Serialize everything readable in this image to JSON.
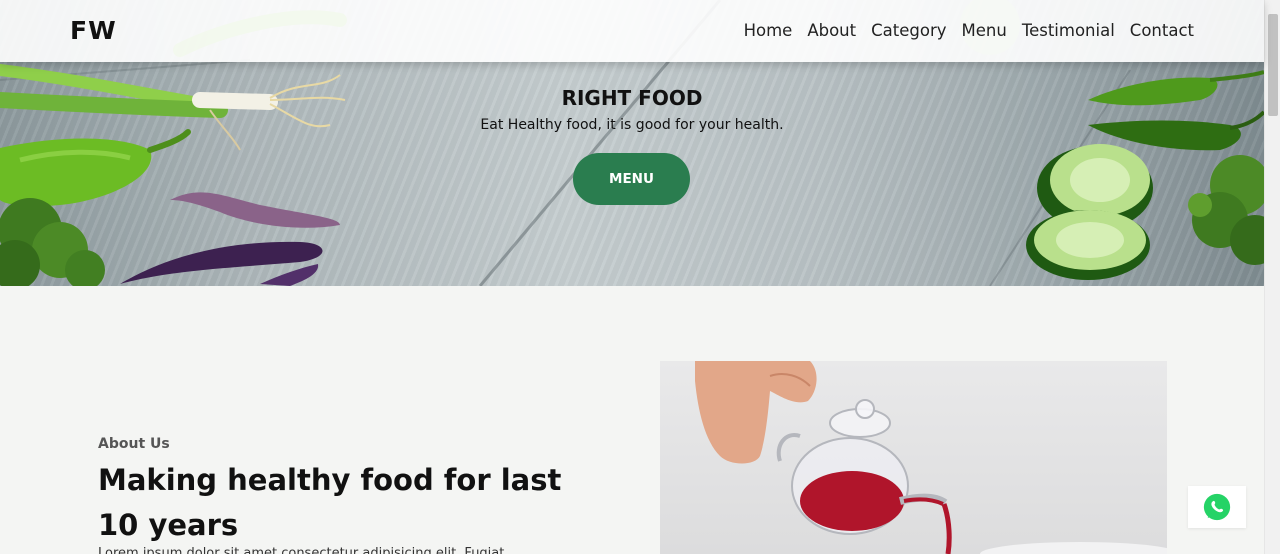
{
  "brand": {
    "logo_text": "FW"
  },
  "nav": {
    "items": [
      {
        "label": "Home"
      },
      {
        "label": "About"
      },
      {
        "label": "Category"
      },
      {
        "label": "Menu"
      },
      {
        "label": "Testimonial"
      },
      {
        "label": "Contact"
      }
    ]
  },
  "hero": {
    "title": "RIGHT FOOD",
    "subtitle": "Eat Healthy food, it is good for your health.",
    "button_label": "MENU"
  },
  "about": {
    "label": "About Us",
    "heading": "Making healthy food for last 10 years",
    "text": "Lorem ipsum dolor sit amet consectetur adipisicing elit. Fugiat"
  },
  "icons": {
    "whatsapp": "whatsapp-icon"
  },
  "colors": {
    "accent": "#2a7d4f",
    "whatsapp": "#25d366"
  }
}
